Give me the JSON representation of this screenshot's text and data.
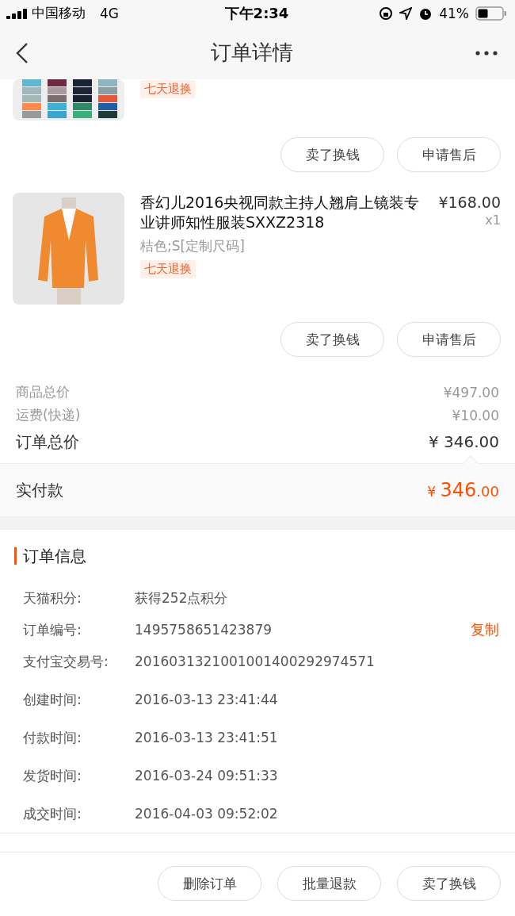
{
  "status_bar": {
    "carrier": "中国移动",
    "network": "4G",
    "time": "下午2:34",
    "battery": "41%"
  },
  "nav": {
    "title": "订单详情"
  },
  "items": [
    {
      "kind": "partial",
      "tag": "七天退换",
      "buttons": [
        "卖了换钱",
        "申请售后"
      ]
    },
    {
      "kind": "full",
      "title": "香幻儿2016央视同款主持人翘肩上镜装专业讲师知性服装SXXZ2318",
      "price": "¥168.00",
      "quantity": "x1",
      "sku": "桔色;S[定制尺码]",
      "tag": "七天退换",
      "buttons": [
        "卖了换钱",
        "申请售后"
      ]
    }
  ],
  "summary": [
    {
      "kind": "minor",
      "label": "商品总价",
      "value": "¥497.00"
    },
    {
      "kind": "minor",
      "label": "运费(快递)",
      "value": "¥10.00"
    },
    {
      "kind": "major",
      "label": "订单总价",
      "value": "¥ 346.00"
    }
  ],
  "paid": {
    "label": "实付款",
    "currency": "¥",
    "integer": "346",
    "decimals": ".00"
  },
  "order_info": {
    "title": "订单信息",
    "rows": [
      {
        "label": "天猫积分:",
        "value": "获得252点积分"
      },
      {
        "label": "订单编号:",
        "value": "1495758651423879",
        "action": "复制"
      },
      {
        "label": "支付宝交易号:",
        "value": "2016031321001001400292974571"
      },
      {
        "label": "创建时间:",
        "value": "2016-03-13 23:41:44"
      },
      {
        "label": "付款时间:",
        "value": "2016-03-13 23:41:51"
      },
      {
        "label": "发货时间:",
        "value": "2016-03-24 09:51:33"
      },
      {
        "label": "成交时间:",
        "value": "2016-04-03 09:52:02"
      }
    ]
  },
  "footer_buttons": [
    "删除订单",
    "批量退款",
    "卖了换钱"
  ]
}
